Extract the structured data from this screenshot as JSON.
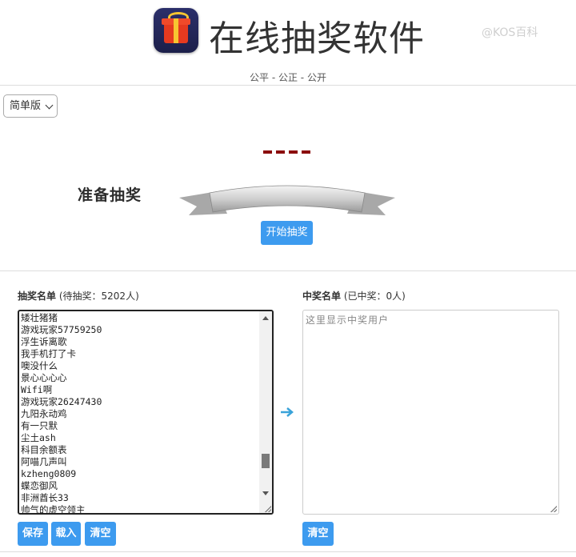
{
  "header": {
    "title": "在线抽奖软件",
    "subtitle": "公平 - 公正 - 公开",
    "watermark": "@KOS百科"
  },
  "mode_select": {
    "value": "简单版"
  },
  "draw": {
    "banner_text": "准备抽奖",
    "start_label": "开始抽奖"
  },
  "participants": {
    "title": "抽奖名单",
    "count_text": "(待抽奖：5202人)",
    "names": [
      "矮壮猪猪",
      "游戏玩家57759250",
      "浮生诉离歌",
      "我手机打了卡",
      "噢没什么",
      "景心心心心",
      "Wifi啊",
      "游戏玩家26247430",
      "九阳永动鸡",
      "有一只默",
      "尘土ash",
      "科目余额表",
      "阿喵几声叫",
      "kzheng0809",
      "蝶恋御风",
      "非洲酋长33",
      "帅气的虚空领主"
    ],
    "save_label": "保存",
    "load_label": "载入",
    "clear_label": "清空"
  },
  "winners": {
    "title": "中奖名单",
    "count_text": "(已中奖：0人)",
    "placeholder": "这里显示中奖用户",
    "clear_label": "清空"
  },
  "colors": {
    "primary": "#3d9bef",
    "dash": "#8b0d0d",
    "arrow": "#3aa3d9"
  }
}
